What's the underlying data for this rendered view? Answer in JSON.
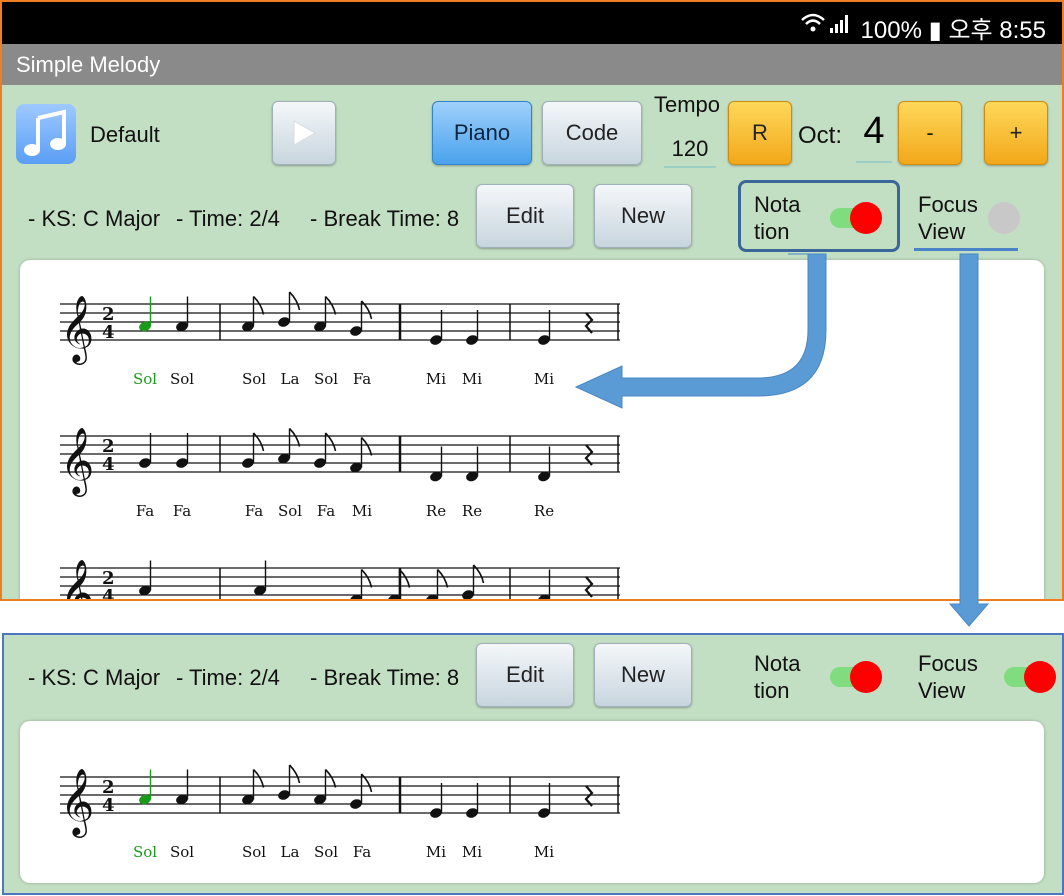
{
  "status": {
    "time_text": "100% ▮ 오후 8:55"
  },
  "app": {
    "title": "Simple Melody"
  },
  "toolbar": {
    "sound_label": "Default",
    "piano_label": "Piano",
    "code_label": "Code",
    "tempo_label": "Tempo",
    "tempo_value": "120",
    "reset_label": "R",
    "oct_label": "Oct:",
    "oct_value": "4",
    "minus_label": "-",
    "plus_label": "+"
  },
  "info": {
    "ks": "- KS: C Major",
    "time": "- Time:  2/4",
    "break_time": "- Break Time: 8",
    "edit_label": "Edit",
    "new_label": "New",
    "notation_line1": "Nota",
    "notation_line2": "tion",
    "focus_line1": "Focus",
    "focus_line2": "View"
  },
  "toggles": {
    "notation_on": true,
    "focus_on_top": false,
    "focus_on_bottom": true
  },
  "colors": {
    "accent_green": "#1a9b1a",
    "toggle_red": "#ff0000",
    "orange_frame": "#ef7d22",
    "blue_frame": "#4b77c2",
    "arrow_blue": "#5b9bd5"
  },
  "score": {
    "rows": [
      {
        "time_sig": [
          "2",
          "4"
        ],
        "syllables": [
          "Sol",
          "Sol",
          "Sol",
          "La",
          "Sol",
          "Fa",
          "Mi",
          "Mi",
          "Mi"
        ]
      },
      {
        "time_sig": [
          "2",
          "4"
        ],
        "syllables": [
          "Fa",
          "Fa",
          "Fa",
          "Sol",
          "Fa",
          "Mi",
          "Re",
          "Re",
          "Re"
        ]
      },
      {
        "time_sig": [
          "2",
          "4"
        ],
        "syllables": []
      }
    ],
    "focus_row": {
      "time_sig": [
        "2",
        "4"
      ],
      "syllables": [
        "Sol",
        "Sol",
        "Sol",
        "La",
        "Sol",
        "Fa",
        "Mi",
        "Mi",
        "Mi"
      ]
    }
  }
}
